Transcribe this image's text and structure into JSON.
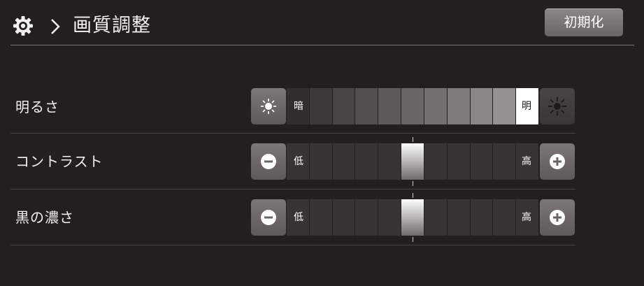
{
  "header": {
    "title": "画質調整",
    "reset_label": "初期化",
    "gear_icon": "gear-icon",
    "chevron_icon": "chevron-right-icon"
  },
  "rows": [
    {
      "label": "明るさ",
      "min_label": "暗",
      "max_label": "明",
      "min_icon": "sun-small-icon",
      "max_icon": "sun-large-icon",
      "level": 11,
      "steps": 11,
      "style": "gradient"
    },
    {
      "label": "コントラスト",
      "min_label": "低",
      "max_label": "高",
      "min_icon": "minus-circle-icon",
      "max_icon": "plus-circle-icon",
      "level": 6,
      "steps": 11,
      "style": "indicator"
    },
    {
      "label": "黒の濃さ",
      "min_label": "低",
      "max_label": "高",
      "min_icon": "minus-circle-icon",
      "max_icon": "plus-circle-icon",
      "level": 6,
      "steps": 11,
      "style": "indicator"
    }
  ],
  "colors": {
    "background": "#231f1f",
    "button": "#7d7777",
    "cell": "#3a3535",
    "active": "#ffffff"
  }
}
